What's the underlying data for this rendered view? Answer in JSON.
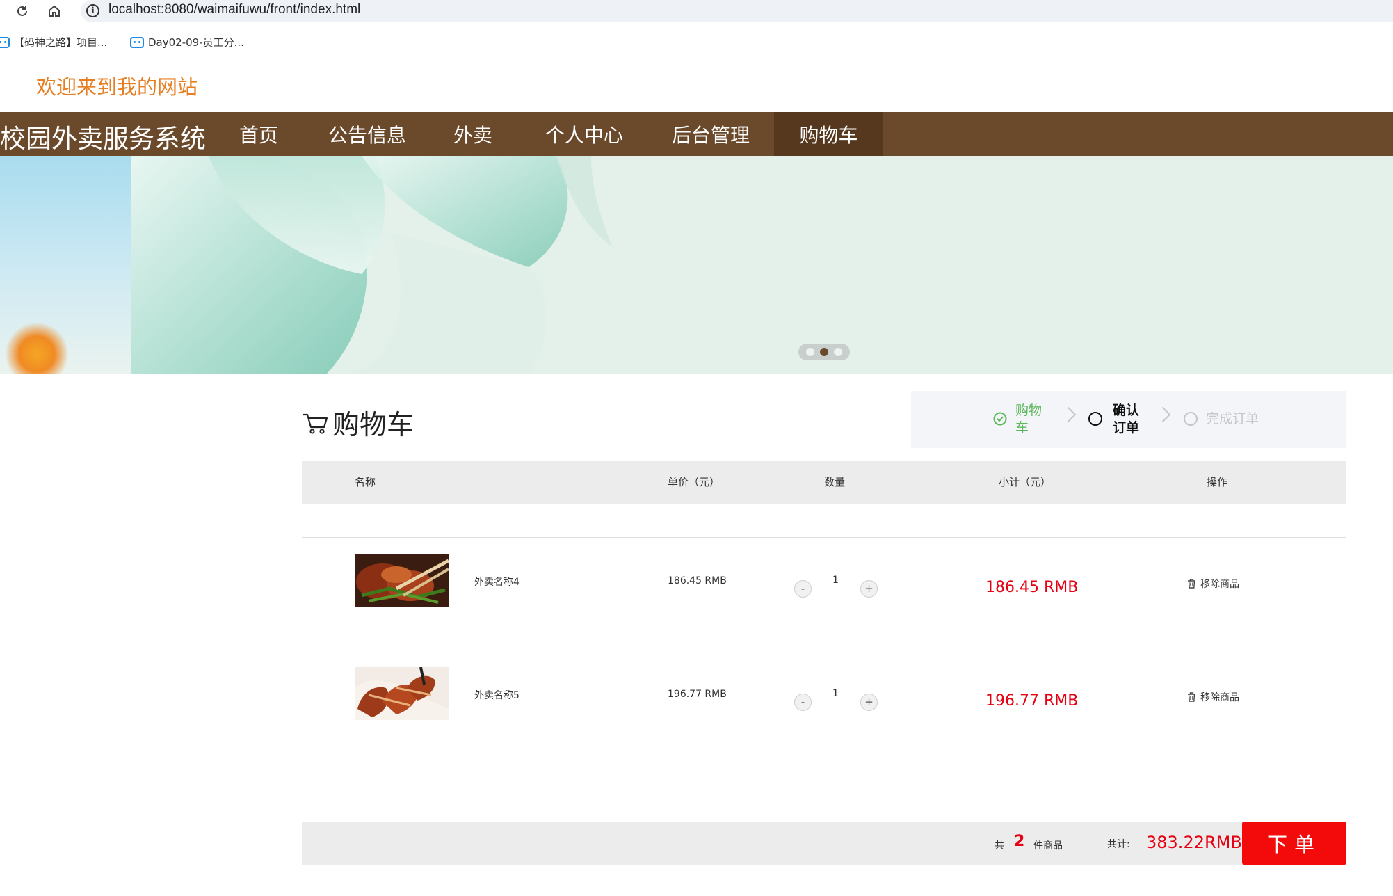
{
  "browser": {
    "url": "localhost:8080/waimaifuwu/front/index.html",
    "bookmarks": [
      {
        "label": "【码神之路】项目..."
      },
      {
        "label": "Day02-09-员工分..."
      }
    ]
  },
  "header": {
    "welcome": "欢迎来到我的网站",
    "site_title": "校园外卖服务系统",
    "nav": [
      {
        "label": "首页"
      },
      {
        "label": "公告信息"
      },
      {
        "label": "外卖"
      },
      {
        "label": "个人中心"
      },
      {
        "label": "后台管理"
      },
      {
        "label": "购物车"
      }
    ],
    "active_nav": "购物车"
  },
  "cart": {
    "title": "购物车",
    "steps": [
      {
        "label": "购物车",
        "state": "done"
      },
      {
        "label": "确认订单",
        "state": "current"
      },
      {
        "label": "完成订单",
        "state": "pending"
      }
    ],
    "columns": {
      "name": "名称",
      "price": "单价（元）",
      "qty": "数量",
      "subtotal": "小计（元）",
      "action": "操作"
    },
    "items": [
      {
        "name": "外卖名称4",
        "price": "186.45 RMB",
        "qty": "1",
        "subtotal": "186.45 RMB",
        "remove": "移除商品"
      },
      {
        "name": "外卖名称5",
        "price": "196.77 RMB",
        "qty": "1",
        "subtotal": "196.77 RMB",
        "remove": "移除商品"
      }
    ],
    "qty_minus": "-",
    "qty_plus": "+",
    "summary": {
      "count_prefix": "共",
      "count": "2",
      "count_suffix": "件商品",
      "total_label": "共计:",
      "total": "383.22RMB",
      "order_button": "下单"
    }
  },
  "colors": {
    "nav_bg": "#6b4a2c",
    "nav_active_bg": "#56381f",
    "welcome": "#e67e22",
    "price_red": "#e50012",
    "order_button": "#f30b0b",
    "step_done": "#5cb85c"
  }
}
